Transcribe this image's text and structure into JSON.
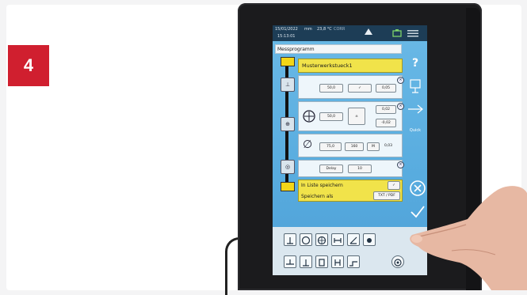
{
  "step": {
    "number": "4"
  },
  "status": {
    "date": "15/01/2022",
    "unit": "mm",
    "temperature": "23,8 °C",
    "mode": "CORR",
    "time": "15:13:01"
  },
  "program": {
    "title": "Messprogramm",
    "name": "Musterwerkstueck1"
  },
  "rows": {
    "row1": {
      "value_a": "50,0",
      "value_b": "0,05"
    },
    "row2": {
      "value_a": "50,0",
      "upper": "0,02",
      "lower": "-0,02"
    },
    "row3": {
      "value_a": "75,0",
      "value_b": "160",
      "value_c": "0,03"
    },
    "row4": {
      "label": "Delay",
      "value": "10"
    }
  },
  "save": {
    "list_label": "In Liste speichern",
    "as_label": "Speichern als",
    "format": "TXT / PDF"
  },
  "sidebar": {
    "help": "?",
    "quick": "Quick"
  },
  "colors": {
    "badge_red": "#d01f2f",
    "screen_blue": "#58acdf",
    "highlight_yellow": "#f1e34a"
  }
}
